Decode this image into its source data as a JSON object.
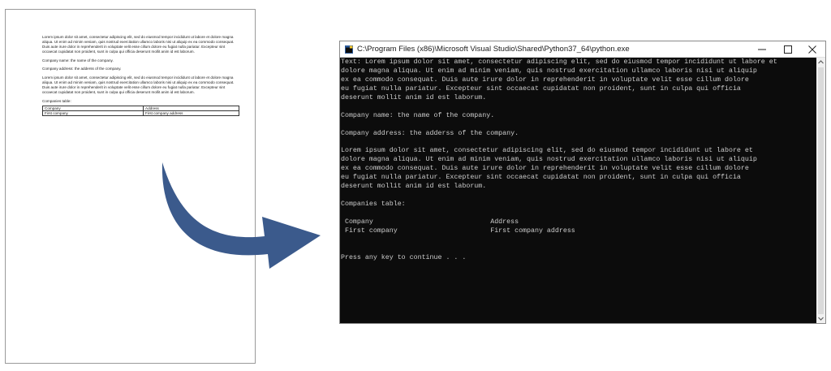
{
  "document": {
    "paragraph1": "Lorem ipsum dolor sit amet, consectetur adipiscing elit, sed do eiusmod tempor incididunt ut labore et dolore magna aliqua. Ut enim ad minim veniam, quis nostrud exercitation ullamco laboris nisi ut aliquip ex ea commodo consequat. Duis aute irure dolor in reprehenderit in voluptate velit esse cillum dolore eu fugiat nulla pariatur. Excepteur sint occaecat cupidatat non proident, sunt in culpa qui officia deserunt mollit anim id est laborum.",
    "company_name": "Company name: the name of the company.",
    "company_address": "Company address: the adderss of the company.",
    "paragraph2": "Lorem ipsum dolor sit amet, consectetur adipiscing elit, sed do eiusmod tempor incididunt ut labore et dolore magna aliqua. Ut enim ad minim veniam, quis nostrud exercitation ullamco laboris nisi ut aliquip ex ea commodo consequat. Duis aute irure dolor in reprehenderit in voluptate velit esse cillum dolore eu fugiat nulla pariatur. Excepteur sint occaecat cupidatat non proident, sunt in culpa qui officia deserunt mollit anim id est laborum.",
    "table_caption": "Companies table:",
    "table_rows": [
      [
        "Company",
        "Address"
      ],
      [
        "First company",
        "First company address"
      ]
    ]
  },
  "arrow": {
    "color": "#3b5a8c",
    "icon": "curved-arrow-icon"
  },
  "window": {
    "title": "C:\\Program Files (x86)\\Microsoft Visual Studio\\Shared\\Python37_64\\python.exe",
    "icons": {
      "app": "python-console-icon",
      "minimize": "minimize-icon",
      "maximize": "maximize-icon",
      "close": "close-icon"
    },
    "console_lines": [
      "Text: Lorem ipsum dolor sit amet, consectetur adipiscing elit, sed do eiusmod tempor incididunt ut labore et",
      "dolore magna aliqua. Ut enim ad minim veniam, quis nostrud exercitation ullamco laboris nisi ut aliquip",
      "ex ea commodo consequat. Duis aute irure dolor in reprehenderit in voluptate velit esse cillum dolore",
      "eu fugiat nulla pariatur. Excepteur sint occaecat cupidatat non proident, sunt in culpa qui officia",
      "deserunt mollit anim id est laborum.",
      "",
      "Company name: the name of the company.",
      "",
      "Company address: the adderss of the company.",
      "",
      "Lorem ipsum dolor sit amet, consectetur adipiscing elit, sed do eiusmod tempor incididunt ut labore et",
      "dolore magna aliqua. Ut enim ad minim veniam, quis nostrud exercitation ullamco laboris nisi ut aliquip",
      "ex ea commodo consequat. Duis aute irure dolor in reprehenderit in voluptate velit esse cillum dolore",
      "eu fugiat nulla pariatur. Excepteur sint occaecat cupidatat non proident, sunt in culpa qui officia",
      "deserunt mollit anim id est laborum.",
      "",
      "Companies table:",
      "",
      " Company                             Address",
      " First company                       First company address",
      "",
      "",
      "Press any key to continue . . ."
    ]
  }
}
